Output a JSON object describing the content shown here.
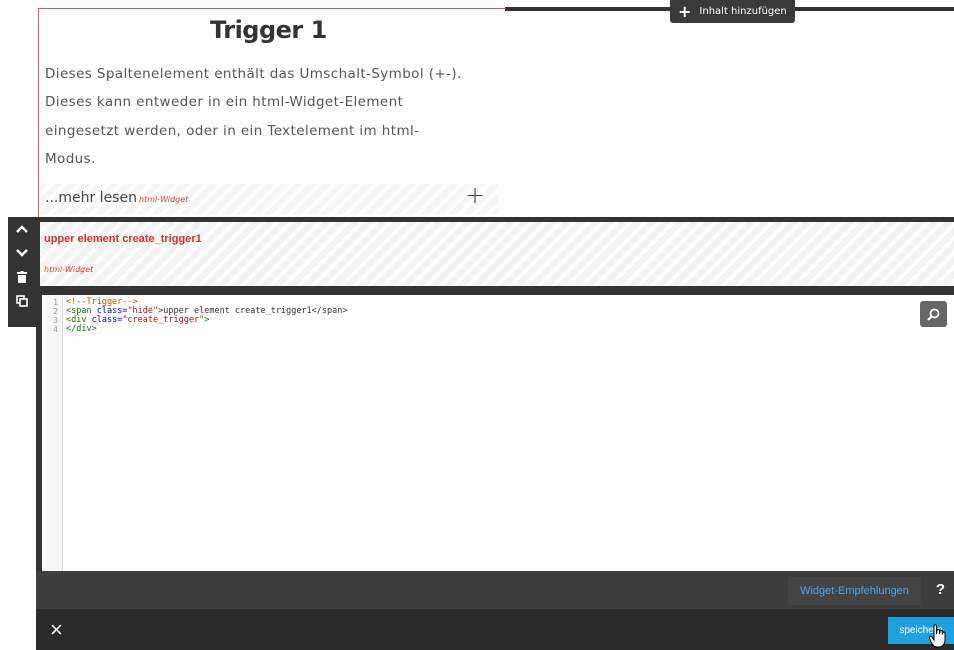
{
  "toolbar": {
    "add_content_label": "Inhalt hinzufügen"
  },
  "element": {
    "title": "Trigger 1",
    "paragraphs": [
      "Dieses Spaltenelement enthält das Umschalt-Symbol (+-).",
      "Dieses kann entweder in ein html-Widget-Element",
      "eingesetzt werden, oder in ein Textelement im html-",
      "Modus."
    ],
    "more_link": "...mehr lesen",
    "more_tag": "html-Widget",
    "plus_symbol": "+"
  },
  "editing": {
    "upper_label": "upper element create_trigger1",
    "widget_tag": "html-Widget"
  },
  "code": {
    "line_numbers": [
      "1",
      "2",
      "3",
      "4"
    ],
    "line1": "<!--Trigger-->",
    "line2_open": "<span ",
    "line2_attr": "class=",
    "line2_str": "\"hide\"",
    "line2_rest": ">upper element create_trigger1</span>",
    "line3_open": "<div ",
    "line3_attr": "class=",
    "line3_str": "\"create_trigger\"",
    "line3_rest": ">",
    "line4": "</div>"
  },
  "bottom": {
    "widget_recommendations": "Widget-Empfehlungen",
    "help": "?",
    "close": "×",
    "save": "speichern"
  },
  "colors": {
    "accent": "#1ea1dc",
    "marker_red": "#e23a3a",
    "dark": "#333333"
  },
  "icons": [
    "plus-icon",
    "chevron-up-icon",
    "chevron-down-icon",
    "trash-icon",
    "duplicate-icon",
    "search-icon",
    "close-icon",
    "hand-cursor-icon"
  ]
}
